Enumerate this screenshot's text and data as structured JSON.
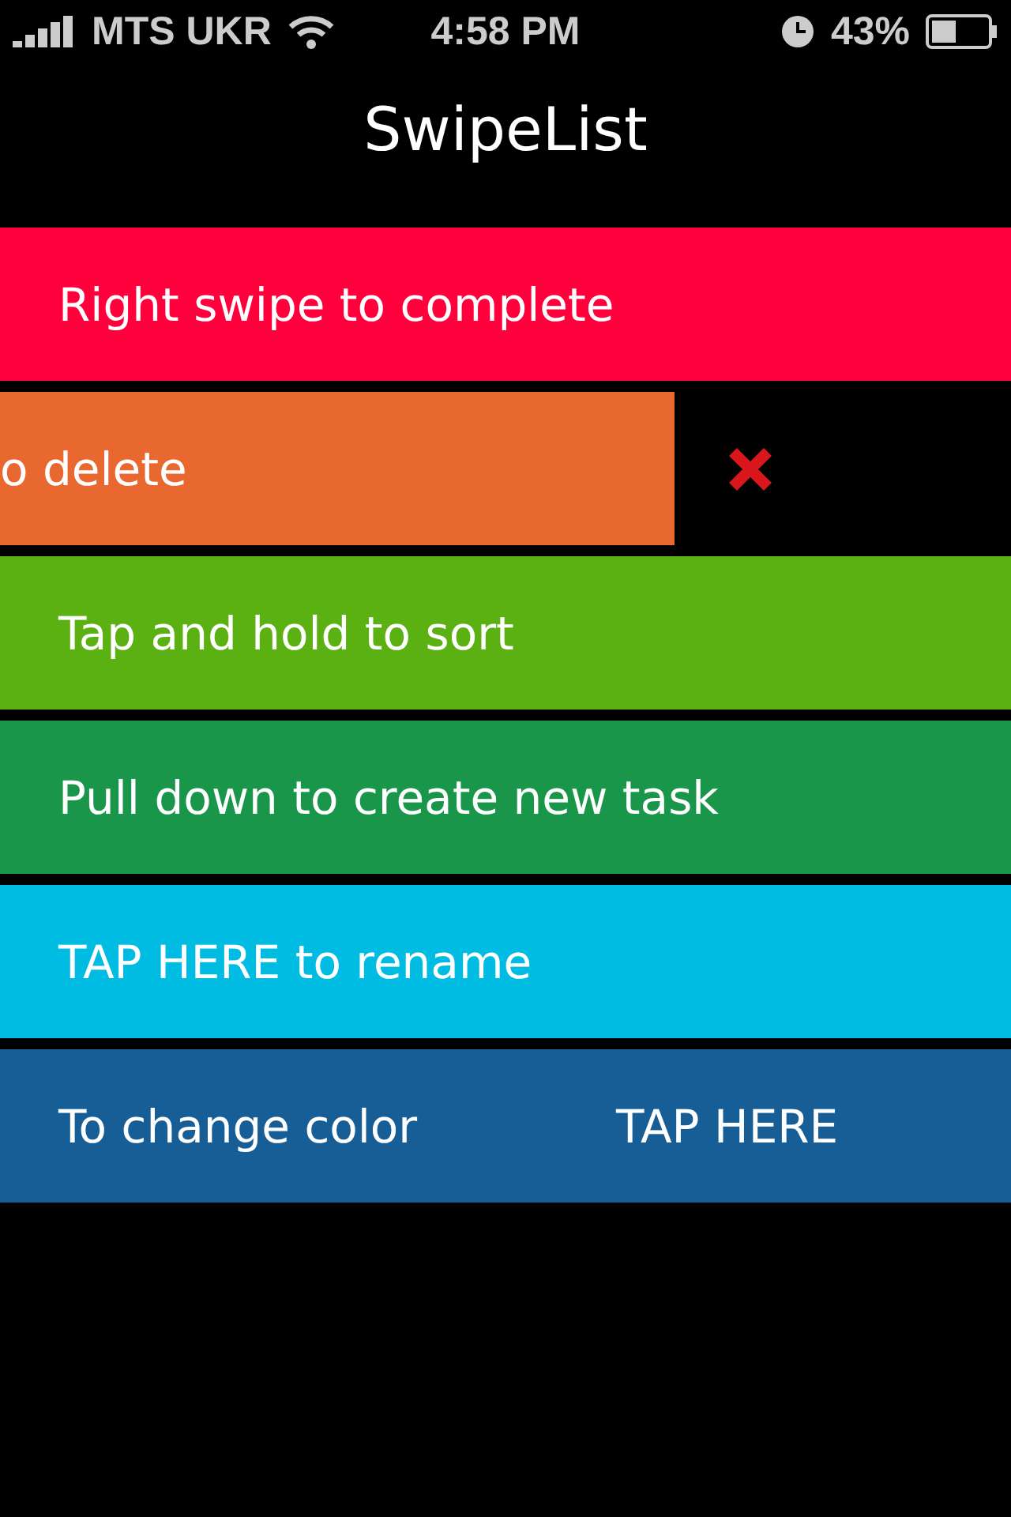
{
  "status_bar": {
    "carrier": "MTS UKR",
    "time": "4:58 PM",
    "battery": "43%"
  },
  "title": "SwipeList",
  "tasks": [
    {
      "kind": "normal",
      "label": "Right swipe to complete",
      "color": "#ff003c"
    },
    {
      "kind": "swiped",
      "label": "o delete",
      "color": "#e86830"
    },
    {
      "kind": "normal",
      "label": "Tap and hold to sort",
      "color": "#5bb012"
    },
    {
      "kind": "normal",
      "label": "Pull down to create new task",
      "color": "#1a964a"
    },
    {
      "kind": "normal",
      "label": "TAP HERE to rename",
      "color": "#00bce2"
    },
    {
      "kind": "split",
      "label": "To change color",
      "action": "TAP HERE",
      "color": "#175e96"
    }
  ]
}
